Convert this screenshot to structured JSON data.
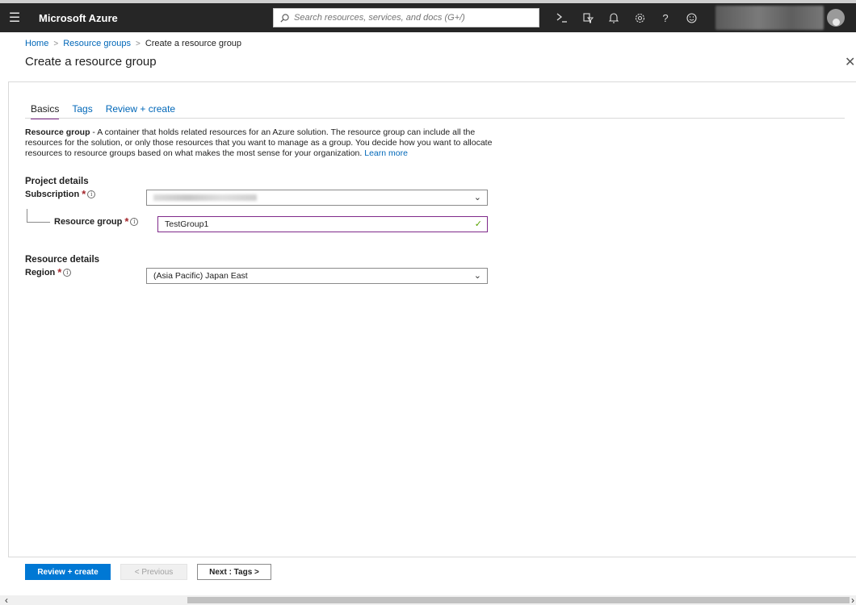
{
  "topbar": {
    "menu_icon": "hamburger-menu-icon",
    "brand": "Microsoft Azure",
    "search_placeholder": "Search resources, services, and docs (G+/)",
    "icons": [
      "cloud-shell-icon",
      "directory-filter-icon",
      "notifications-icon",
      "settings-icon",
      "help-icon",
      "feedback-icon"
    ]
  },
  "breadcrumb": {
    "home": "Home",
    "resource_groups": "Resource groups",
    "current": "Create a resource group"
  },
  "page_title": "Create a resource group",
  "tabs": [
    {
      "label": "Basics",
      "active": true
    },
    {
      "label": "Tags",
      "active": false
    },
    {
      "label": "Review + create",
      "active": false
    }
  ],
  "description": {
    "term": "Resource group",
    "text": " - A container that holds related resources for an Azure solution. The resource group can include all the resources for the solution, or only those resources that you want to manage as a group. You decide how you want to allocate resources to resource groups based on what makes the most sense for your organization. ",
    "learn_more": "Learn more"
  },
  "project_details": {
    "heading": "Project details",
    "subscription_label": "Subscription",
    "resource_group_label": "Resource group",
    "resource_group_value": "TestGroup1"
  },
  "resource_details": {
    "heading": "Resource details",
    "region_label": "Region",
    "region_value": "(Asia Pacific) Japan East"
  },
  "footer": {
    "review_create": "Review + create",
    "previous": "< Previous",
    "next": "Next : Tags >"
  },
  "colors": {
    "topbar_bg": "#262626",
    "link": "#0067b8",
    "primary_button": "#0078d4",
    "active_tab_underline": "#7f2a8a",
    "required_star": "#a4262c",
    "valid_check": "#57a300"
  }
}
